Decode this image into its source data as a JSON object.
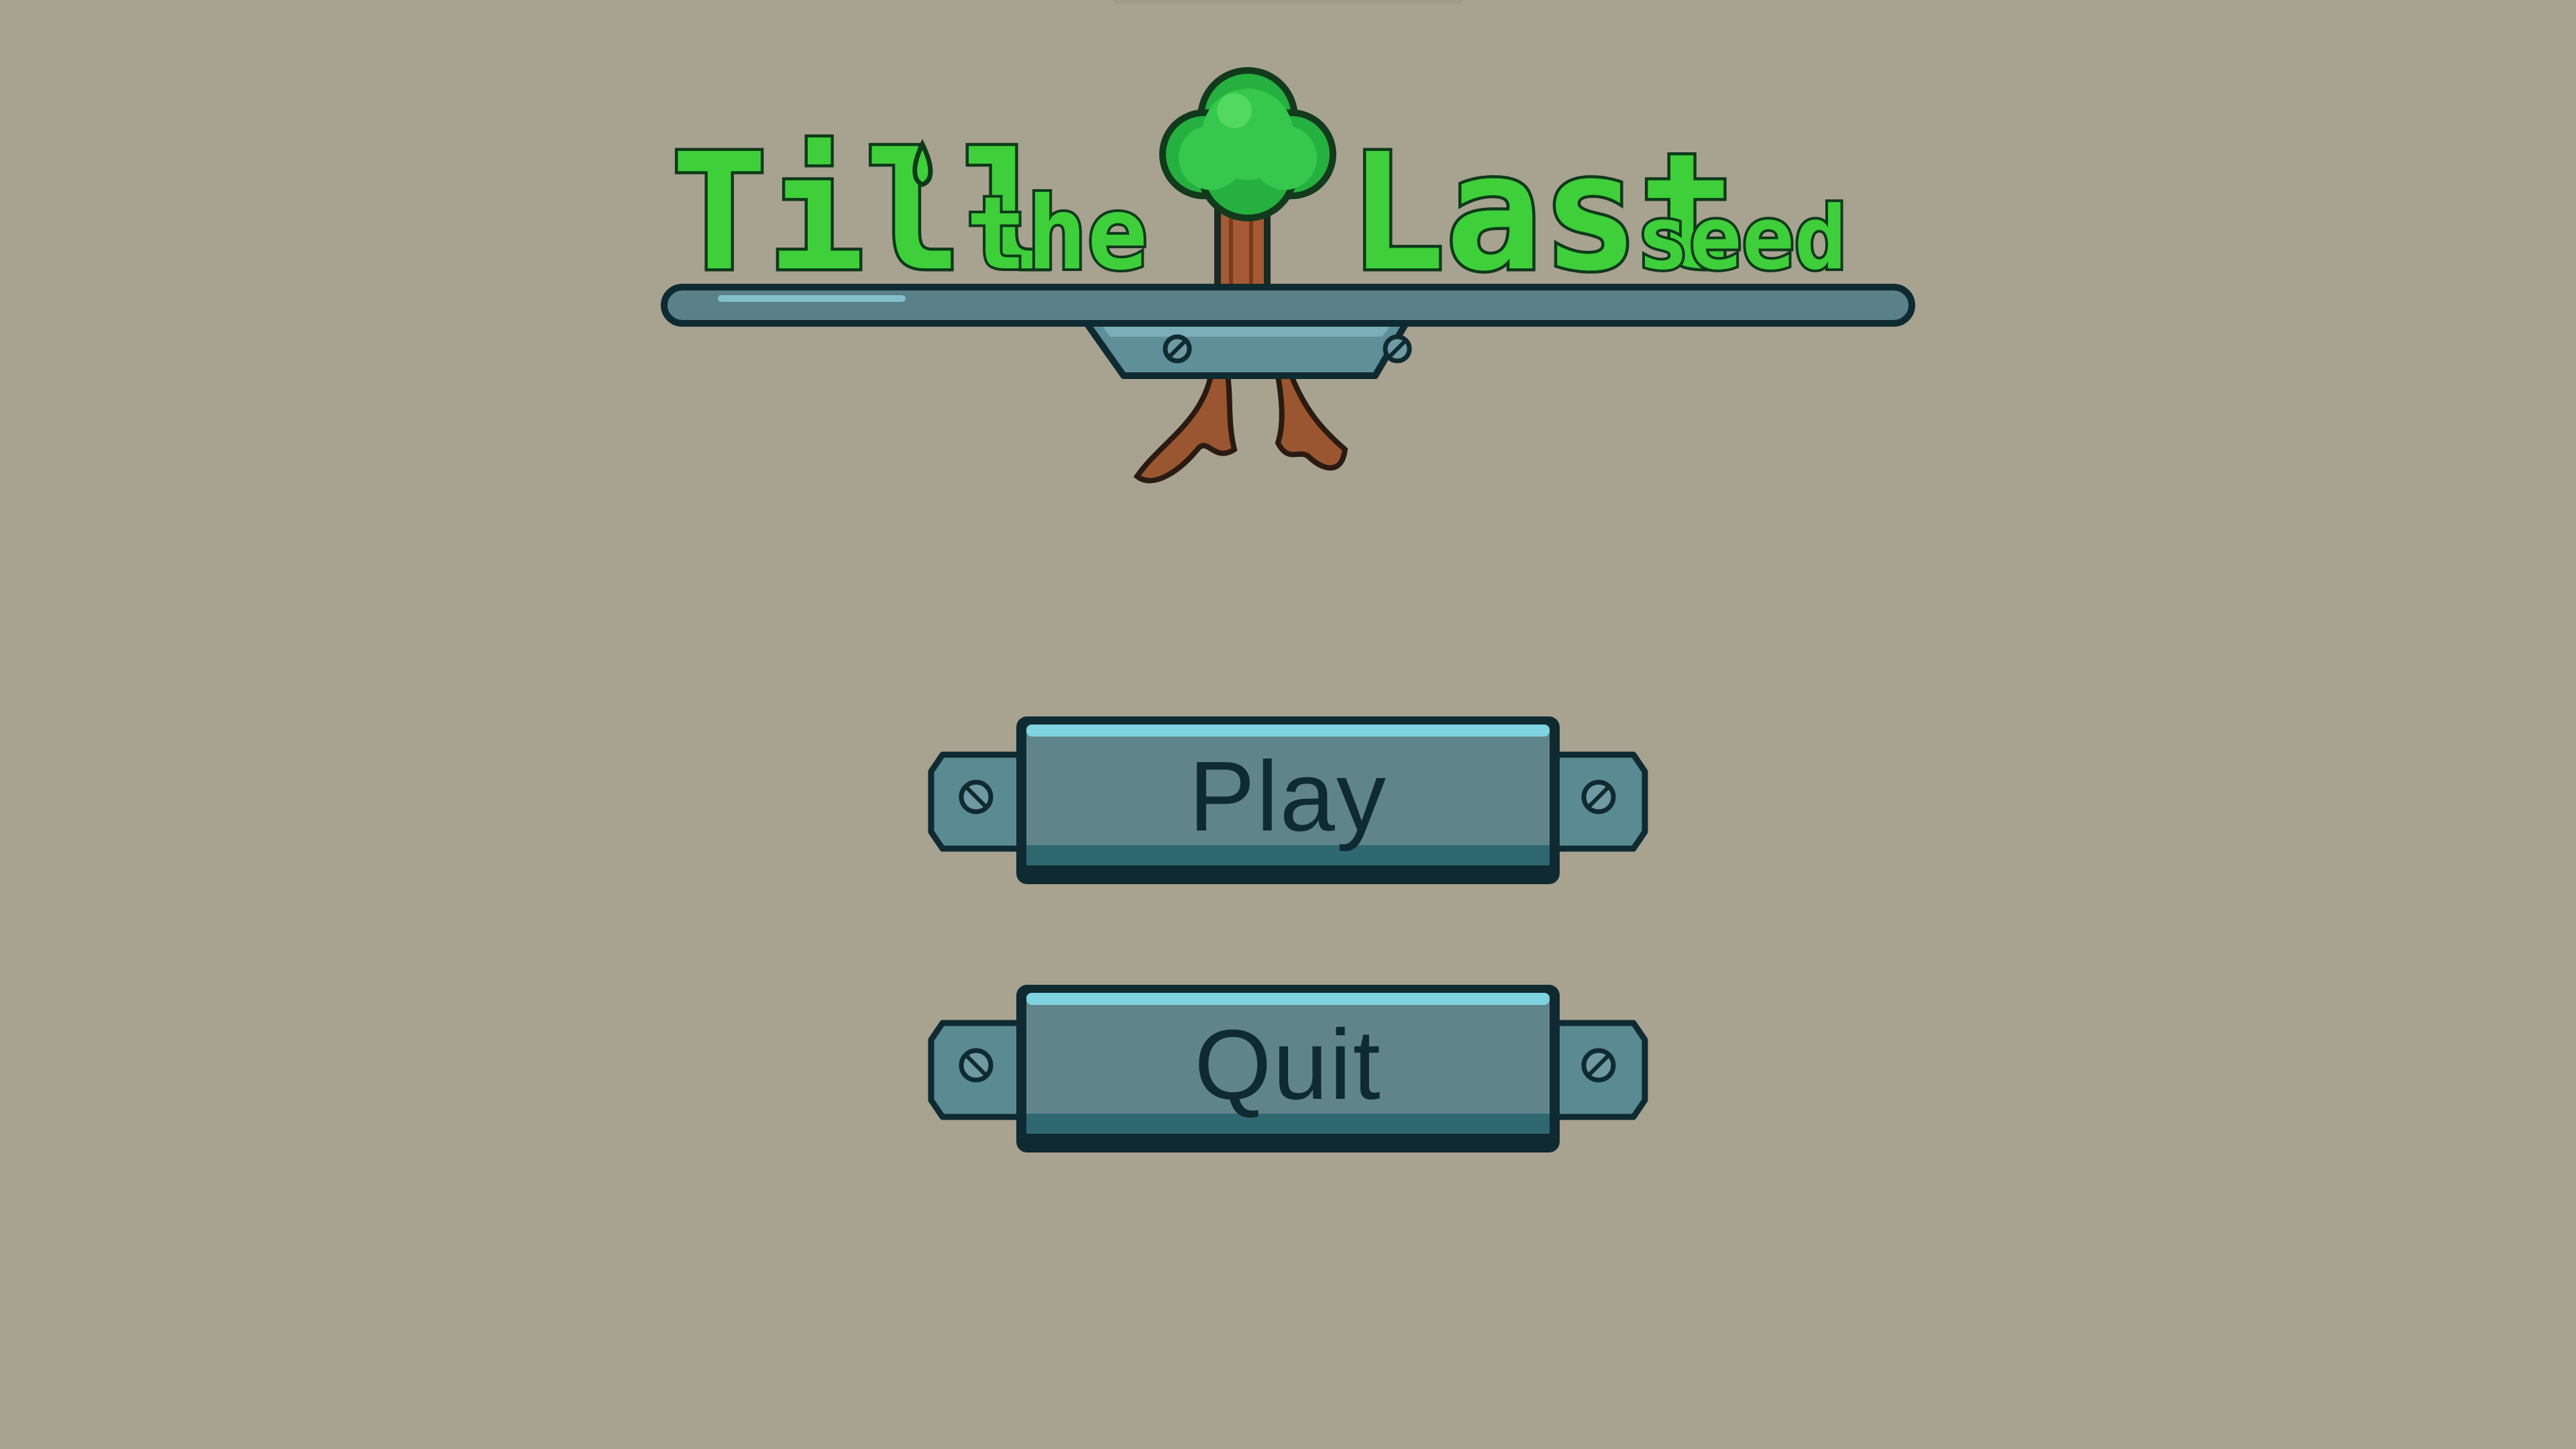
{
  "game": {
    "title_words": [
      "Till",
      "the",
      "Last",
      "seed"
    ],
    "title_full": "Till' the Last seed"
  },
  "menu": {
    "play_label": "Play",
    "quit_label": "Quit"
  },
  "colors": {
    "background": "#a8a291",
    "title_green": "#3fcf3a",
    "title_outline": "#0e3a1a",
    "button_face": "#5f858a",
    "button_dark": "#0f2a31",
    "button_highlight": "#7fd3e0",
    "root_brown": "#8a4a2a"
  }
}
